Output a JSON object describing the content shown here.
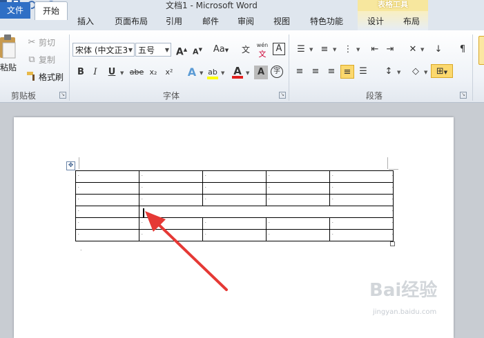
{
  "window": {
    "title": "文档1 - Microsoft Word",
    "context_tab_group": "表格工具"
  },
  "tabs": {
    "file": "文件",
    "home": "开始",
    "insert": "插入",
    "page_layout": "页面布局",
    "references": "引用",
    "mailings": "邮件",
    "review": "审阅",
    "view": "视图",
    "special": "特色功能",
    "design": "设计",
    "layout": "布局"
  },
  "clipboard": {
    "paste": "粘贴",
    "cut": "剪切",
    "copy": "复制",
    "format_painter": "格式刷",
    "group_label": "剪贴板"
  },
  "font": {
    "font_name": "宋体 (中文正3",
    "font_size": "五号",
    "grow": "A",
    "shrink": "A",
    "change_case": "Aa",
    "wen": "文",
    "phonetic": "wén",
    "border_char": "A",
    "bold": "B",
    "italic": "I",
    "underline": "U",
    "strike": "abe",
    "subscript": "x₂",
    "superscript": "x²",
    "effects": "A",
    "highlight": "ab",
    "font_color": "A",
    "shading": "A",
    "enclose": "字",
    "group_label": "字体"
  },
  "paragraph": {
    "group_label": "段落"
  },
  "document": {
    "table_rows": 6,
    "table_cols": 5,
    "merged_row_index": 3,
    "cell_mark": ".",
    "end_mark": "."
  },
  "watermark": {
    "brand": "Bai经验",
    "url": "jingyan.baidu.com"
  },
  "colors": {
    "accent_file_tab": "#2f6fc5",
    "context_tab": "#f7e79e",
    "highlight_yellow": "#ffff00",
    "font_red": "#e02020",
    "arrow_red": "#e53935"
  }
}
